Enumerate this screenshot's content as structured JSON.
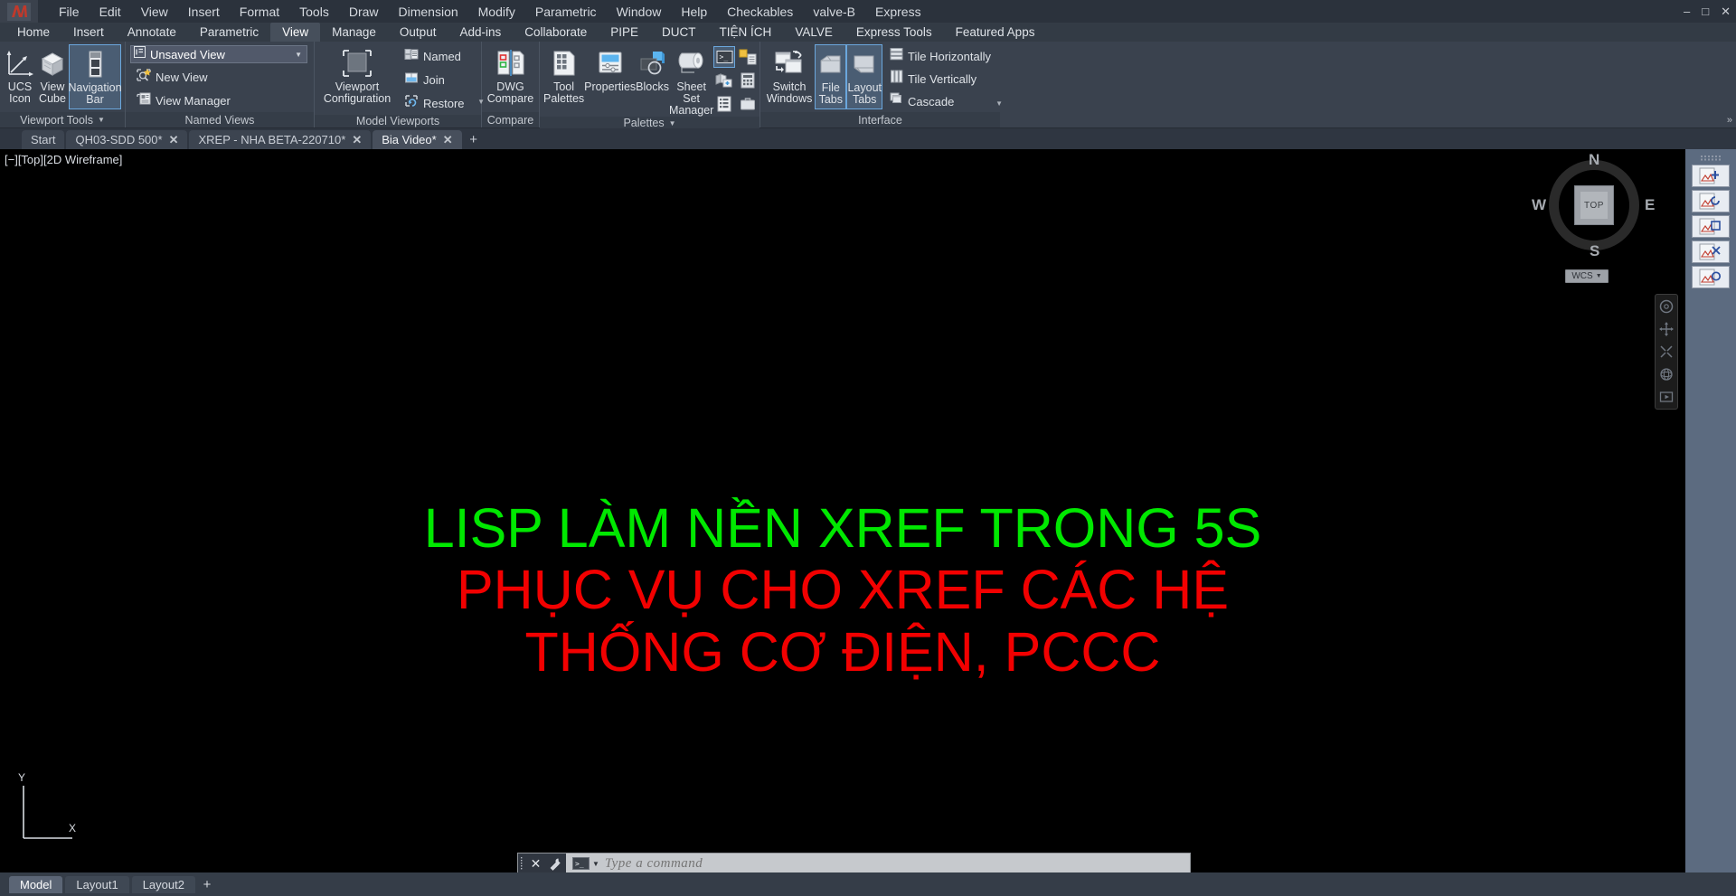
{
  "colors": {
    "accent": "#6ba7dd",
    "ribbon_bg": "#3a424e",
    "titlebar_bg": "#2b323c",
    "canvas_bg": "#000000",
    "text_green": "#00e800",
    "text_red": "#f20000"
  },
  "titlebar": {
    "logo_name": "autocad-logo",
    "menus": [
      "File",
      "Edit",
      "View",
      "Insert",
      "Format",
      "Tools",
      "Draw",
      "Dimension",
      "Modify",
      "Parametric",
      "Window",
      "Help",
      "Checkables",
      "valve-B",
      "Express"
    ],
    "window_controls": {
      "minimize": "–",
      "maximize": "□",
      "close": "✕"
    }
  },
  "ribbon": {
    "tabs": [
      {
        "label": "Home",
        "active": false
      },
      {
        "label": "Insert",
        "active": false
      },
      {
        "label": "Annotate",
        "active": false
      },
      {
        "label": "Parametric",
        "active": false
      },
      {
        "label": "View",
        "active": true
      },
      {
        "label": "Manage",
        "active": false
      },
      {
        "label": "Output",
        "active": false
      },
      {
        "label": "Add-ins",
        "active": false
      },
      {
        "label": "Collaborate",
        "active": false
      },
      {
        "label": "PIPE",
        "active": false
      },
      {
        "label": "DUCT",
        "active": false
      },
      {
        "label": "TIỆN ÍCH",
        "active": false
      },
      {
        "label": "VALVE",
        "active": false
      },
      {
        "label": "Express Tools",
        "active": false
      },
      {
        "label": "Featured Apps",
        "active": false
      }
    ],
    "panels": [
      {
        "title": "Viewport Tools",
        "has_dropdown": true,
        "buttons": [
          {
            "label_line1": "UCS",
            "label_line2": "Icon",
            "icon": "ucs-icon-axes",
            "selected": false
          },
          {
            "label_line1": "View",
            "label_line2": "Cube",
            "icon": "view-cube-icon",
            "selected": false
          },
          {
            "label_line1": "Navigation",
            "label_line2": "Bar",
            "icon": "navigation-bar-icon",
            "selected": true
          }
        ]
      },
      {
        "title": "Named Views",
        "has_dropdown": false,
        "combo_value": "Unsaved View",
        "items": [
          {
            "label": "New View",
            "icon": "new-view-icon"
          },
          {
            "label": "View Manager",
            "icon": "view-manager-icon"
          }
        ]
      },
      {
        "title": "Model Viewports",
        "has_dropdown": false,
        "big_button": {
          "label_line1": "Viewport",
          "label_line2": "Configuration",
          "icon": "viewport-configuration-icon"
        },
        "items": [
          {
            "label": "Named",
            "icon": "named-viewport-icon"
          },
          {
            "label": "Join",
            "icon": "join-viewport-icon"
          },
          {
            "label": "Restore",
            "icon": "restore-viewport-icon"
          }
        ]
      },
      {
        "title": "Compare",
        "has_dropdown": false,
        "buttons": [
          {
            "label_line1": "DWG",
            "label_line2": "Compare",
            "icon": "dwg-compare-icon",
            "selected": false
          }
        ]
      },
      {
        "title": "Palettes",
        "has_dropdown": true,
        "buttons": [
          {
            "label_line1": "Tool",
            "label_line2": "Palettes",
            "icon": "tool-palettes-icon",
            "selected": false
          },
          {
            "label_line1": "Properties",
            "label_line2": "",
            "icon": "properties-icon",
            "selected": false
          },
          {
            "label_line1": "Blocks",
            "label_line2": "",
            "icon": "blocks-icon",
            "selected": false
          },
          {
            "label_line1": "Sheet Set",
            "label_line2": "Manager",
            "icon": "sheet-set-manager-icon",
            "selected": false
          }
        ],
        "grid_icons": [
          {
            "icon": "command-line-icon",
            "selected": true
          },
          {
            "icon": "design-center-icon",
            "selected": false
          },
          {
            "icon": "external-references-icon",
            "selected": false
          },
          {
            "icon": "quick-calc-icon",
            "selected": false
          },
          {
            "icon": "markup-set-manager-icon",
            "selected": false
          },
          {
            "icon": "materials-browser-icon",
            "selected": false
          }
        ]
      },
      {
        "title": "Interface",
        "has_dropdown": false,
        "buttons": [
          {
            "label_line1": "Switch",
            "label_line2": "Windows",
            "icon": "switch-windows-icon",
            "selected": false,
            "has_dropdown": true
          },
          {
            "label_line1": "File",
            "label_line2": "Tabs",
            "icon": "file-tabs-icon",
            "selected": true
          },
          {
            "label_line1": "Layout",
            "label_line2": "Tabs",
            "icon": "layout-tabs-icon",
            "selected": true
          }
        ],
        "items": [
          {
            "label": "Tile Horizontally",
            "icon": "tile-horizontally-icon"
          },
          {
            "label": "Tile Vertically",
            "icon": "tile-vertically-icon"
          },
          {
            "label": "Cascade",
            "icon": "cascade-icon"
          }
        ]
      }
    ]
  },
  "file_tabs": {
    "tabs": [
      {
        "label": "Start",
        "closable": false,
        "active": false
      },
      {
        "label": "QH03-SDD 500*",
        "closable": true,
        "active": false
      },
      {
        "label": "XREP - NHA BETA-220710*",
        "closable": true,
        "active": false
      },
      {
        "label": "Bia Video*",
        "closable": true,
        "active": true
      }
    ],
    "add_label": "+"
  },
  "canvas": {
    "viewport_label": "[−][Top][2D Wireframe]",
    "text_lines": [
      {
        "text": "LISP LÀM NỀN XREF TRONG 5S",
        "color": "#00e800"
      },
      {
        "text": "PHỤC VỤ CHO XREF CÁC HỆ",
        "color": "#f20000"
      },
      {
        "text": "THỐNG CƠ ĐIỆN, PCCC",
        "color": "#f20000"
      }
    ],
    "viewcube": {
      "face_label": "TOP",
      "north": "N",
      "south": "S",
      "west": "W",
      "east": "E",
      "wcs_label": "WCS"
    },
    "ucs_icon": {
      "y_label": "Y",
      "x_label": "X"
    },
    "nav_bar_icons": [
      "full-navigation-wheel-icon",
      "pan-icon",
      "zoom-extents-icon",
      "orbit-icon",
      "show-motion-icon"
    ],
    "right_strip_icons": [
      "xref-attach-icon-1",
      "xref-attach-icon-2",
      "xref-attach-icon-3",
      "xref-attach-icon-4",
      "xref-attach-icon-5"
    ]
  },
  "command_line": {
    "placeholder": "Type a command",
    "value": "",
    "close_glyph": "✕",
    "tool_icon": "wrench-icon",
    "prompt_icon": "command-prompt-icon"
  },
  "status_bar": {
    "layout_tabs": [
      {
        "label": "Model",
        "active": true
      },
      {
        "label": "Layout1",
        "active": false
      },
      {
        "label": "Layout2",
        "active": false
      }
    ],
    "add_label": "+"
  }
}
